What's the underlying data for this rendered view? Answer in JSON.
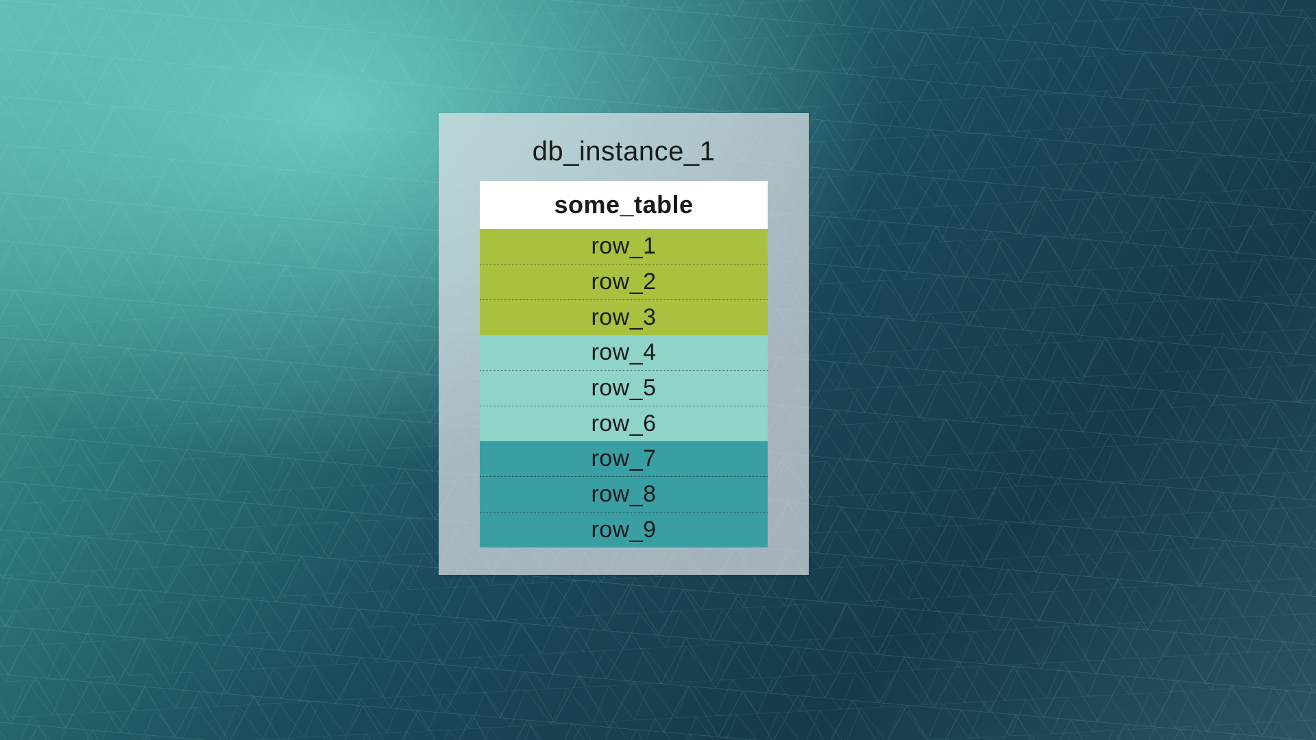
{
  "database": {
    "instance_label": "db_instance_1",
    "table": {
      "name": "some_table",
      "row_groups": [
        {
          "color": "#a8c23f",
          "rows": [
            "row_1",
            "row_2",
            "row_3"
          ]
        },
        {
          "color": "#8fd4c9",
          "rows": [
            "row_4",
            "row_5",
            "row_6"
          ]
        },
        {
          "color": "#3a9fa3",
          "rows": [
            "row_7",
            "row_8",
            "row_9"
          ]
        }
      ]
    }
  }
}
